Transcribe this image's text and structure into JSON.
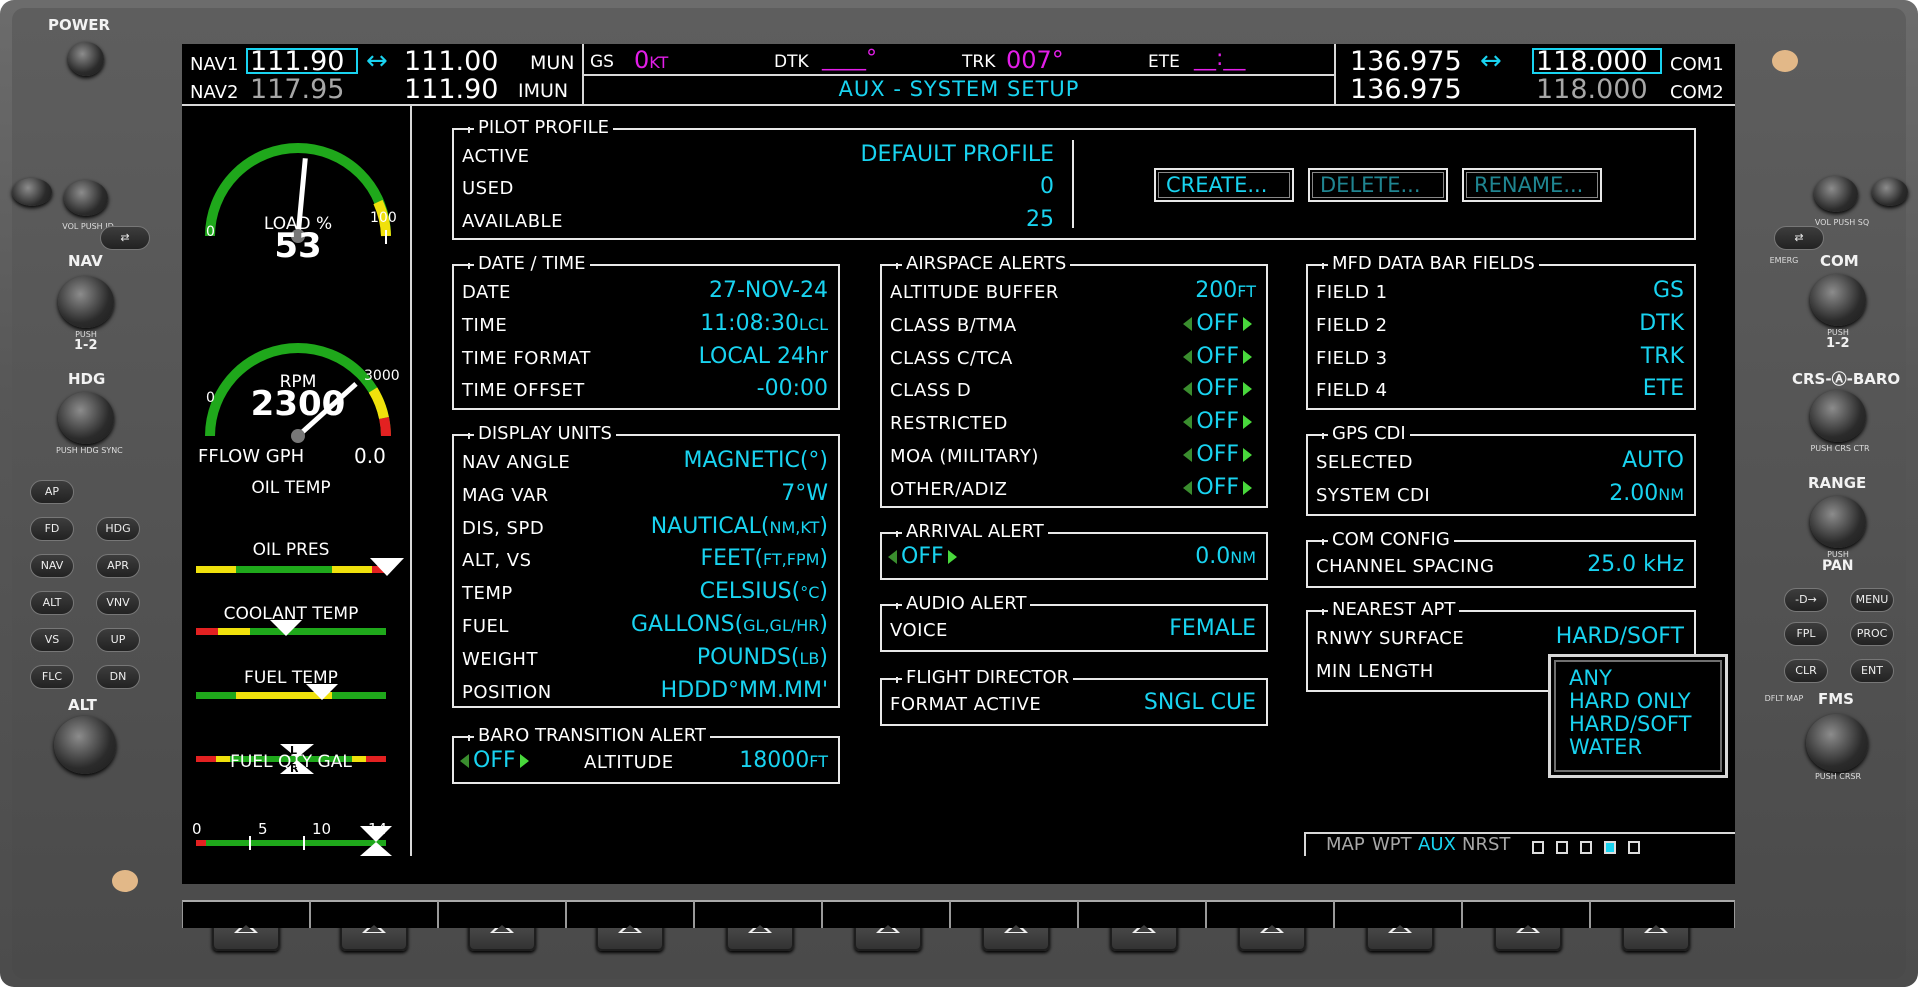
{
  "bezel": {
    "power": "POWER",
    "vol_push_id_left": "VOL PUSH ID",
    "nav": "NAV",
    "push_12_left": "PUSH",
    "one_two_left": "1-2",
    "hdg": "HDG",
    "push_hdg_sync": "PUSH HDG SYNC",
    "ap": "AP",
    "fd": "FD",
    "hdg_btn": "HDG",
    "nav_btn": "NAV",
    "apr": "APR",
    "alt_btn": "ALT",
    "vnv": "VNV",
    "vs": "VS",
    "up": "UP",
    "flc": "FLC",
    "dn": "DN",
    "alt": "ALT",
    "vol_push_sq": "VOL PUSH SQ",
    "emerg": "EMERG",
    "com": "COM",
    "push_12_right": "PUSH",
    "one_two_right": "1-2",
    "crs_baro": "CRS-Ⓐ-BARO",
    "push_crs_ctr": "PUSH CRS CTR",
    "range": "RANGE",
    "push_pan": "PUSH",
    "pan": "PAN",
    "direct": "-D→",
    "menu": "MENU",
    "fpl": "FPL",
    "proc": "PROC",
    "clr": "CLR",
    "ent": "ENT",
    "dflt_map": "DFLT MAP",
    "fms": "FMS",
    "push_crsr": "PUSH CRSR"
  },
  "header": {
    "nav1_label": "NAV1",
    "nav1_active": "111.90",
    "nav1_swap": "↔",
    "nav1_standby": "111.00",
    "nav1_ident": "MUN",
    "nav2_label": "NAV2",
    "nav2_active": "117.95",
    "nav2_standby": "111.90",
    "nav2_ident": "IMUN",
    "gs_label": "GS",
    "gs_value": "0",
    "gs_unit": "KT",
    "dtk_label": "DTK",
    "dtk_value": "____°",
    "trk_label": "TRK",
    "trk_value": "007°",
    "ete_label": "ETE",
    "ete_value": "__:__",
    "page_title": "AUX - SYSTEM SETUP",
    "com1_standby": "136.975",
    "com_swap": "↔",
    "com1_active": "118.000",
    "com1_label": "COM1",
    "com2_standby": "136.975",
    "com2_active": "118.000",
    "com2_label": "COM2"
  },
  "eis": {
    "load_label": "LOAD %",
    "load_value": "53",
    "load_min": "0",
    "load_max": "100",
    "load_pct": 53,
    "rpm_label": "RPM",
    "rpm_value": "2300",
    "rpm_min": "0",
    "rpm_max": "3000",
    "rpm_fraction": 0.767,
    "fflow_label": "FFLOW GPH",
    "fflow_value": "0.0",
    "oil_temp": "OIL TEMP",
    "oil_pres": "OIL PRES",
    "coolant_temp": "COOLANT TEMP",
    "fuel_temp": "FUEL TEMP",
    "fuel_qty": "FUEL QTY GAL",
    "fuel_qty_ticks": [
      "0",
      "5",
      "10",
      "14"
    ],
    "left_marker": "L",
    "right_marker": "R"
  },
  "pilot_profile": {
    "title": "PILOT PROFILE",
    "active_label": "ACTIVE",
    "active_value": "DEFAULT PROFILE",
    "used_label": "USED",
    "used_value": "0",
    "available_label": "AVAILABLE",
    "available_value": "25",
    "create": "CREATE...",
    "delete": "DELETE...",
    "rename": "RENAME..."
  },
  "date_time": {
    "title": "DATE / TIME",
    "rows": [
      {
        "label": "DATE",
        "value": "27-NOV-24",
        "unit": ""
      },
      {
        "label": "TIME",
        "value": "11:08:30",
        "unit": "LCL"
      },
      {
        "label": "TIME FORMAT",
        "value": "LOCAL 24hr",
        "unit": ""
      },
      {
        "label": "TIME OFFSET",
        "value": "-00:00",
        "unit": ""
      }
    ]
  },
  "display_units": {
    "title": "DISPLAY UNITS",
    "rows": [
      {
        "label": "NAV ANGLE",
        "value": "MAGNETIC(°)",
        "unit": ""
      },
      {
        "label": "MAG VAR",
        "value": "7°W",
        "unit": ""
      },
      {
        "label": "DIS, SPD",
        "value": "NAUTICAL(",
        "unit": "NM,KT",
        "close": ")"
      },
      {
        "label": "ALT, VS",
        "value": "FEET(",
        "unit": "FT,FPM",
        "close": ")"
      },
      {
        "label": "TEMP",
        "value": "CELSIUS(",
        "unit": "°C",
        "close": ")"
      },
      {
        "label": "FUEL",
        "value": "GALLONS(",
        "unit": "GL,GL/HR",
        "close": ")"
      },
      {
        "label": "WEIGHT",
        "value": "POUNDS(",
        "unit": "LB",
        "close": ")"
      },
      {
        "label": "POSITION",
        "value": "HDDD°MM.MM'",
        "unit": ""
      }
    ]
  },
  "baro_alert": {
    "title": "BARO TRANSITION ALERT",
    "state": "OFF",
    "altitude_label": "ALTITUDE",
    "altitude_value": "18000",
    "altitude_unit": "FT"
  },
  "airspace_alerts": {
    "title": "AIRSPACE ALERTS",
    "buffer_label": "ALTITUDE BUFFER",
    "buffer_value": "200",
    "buffer_unit": "FT",
    "rows": [
      {
        "label": "CLASS B/TMA",
        "value": "OFF"
      },
      {
        "label": "CLASS C/TCA",
        "value": "OFF"
      },
      {
        "label": "CLASS D",
        "value": "OFF"
      },
      {
        "label": "RESTRICTED",
        "value": "OFF"
      },
      {
        "label": "MOA (MILITARY)",
        "value": "OFF"
      },
      {
        "label": "OTHER/ADIZ",
        "value": "OFF"
      }
    ]
  },
  "arrival_alert": {
    "title": "ARRIVAL ALERT",
    "state": "OFF",
    "distance": "0.0",
    "unit": "NM"
  },
  "audio_alert": {
    "title": "AUDIO ALERT",
    "voice_label": "VOICE",
    "voice_value": "FEMALE"
  },
  "flight_director": {
    "title": "FLIGHT DIRECTOR",
    "format_label": "FORMAT ACTIVE",
    "format_value": "SNGL CUE"
  },
  "mfd_fields": {
    "title": "MFD DATA BAR FIELDS",
    "rows": [
      {
        "label": "FIELD 1",
        "value": "GS"
      },
      {
        "label": "FIELD 2",
        "value": "DTK"
      },
      {
        "label": "FIELD 3",
        "value": "TRK"
      },
      {
        "label": "FIELD 4",
        "value": "ETE"
      }
    ]
  },
  "gps_cdi": {
    "title": "GPS CDI",
    "selected_label": "SELECTED",
    "selected_value": "AUTO",
    "system_label": "SYSTEM CDI",
    "system_value": "2.00",
    "system_unit": "NM"
  },
  "com_config": {
    "title": "COM CONFIG",
    "spacing_label": "CHANNEL SPACING",
    "spacing_value": "25.0 kHz"
  },
  "nearest_apt": {
    "title": "NEAREST APT",
    "surface_label": "RNWY SURFACE",
    "surface_value": "HARD/SOFT",
    "min_length_label": "MIN LENGTH"
  },
  "surface_popup": {
    "options": [
      "ANY",
      "HARD ONLY",
      "HARD/SOFT",
      "WATER"
    ]
  },
  "page_group": {
    "items": [
      "MAP",
      "WPT",
      "AUX",
      "NRST"
    ],
    "active": "AUX",
    "page_count": 5,
    "active_page_index": 3
  },
  "colors": {
    "cyan": "#19d3f0",
    "magenta": "#e21ee8",
    "green_arc": "#1fa81b",
    "yellow": "#f0e10c",
    "red": "#e32121"
  }
}
